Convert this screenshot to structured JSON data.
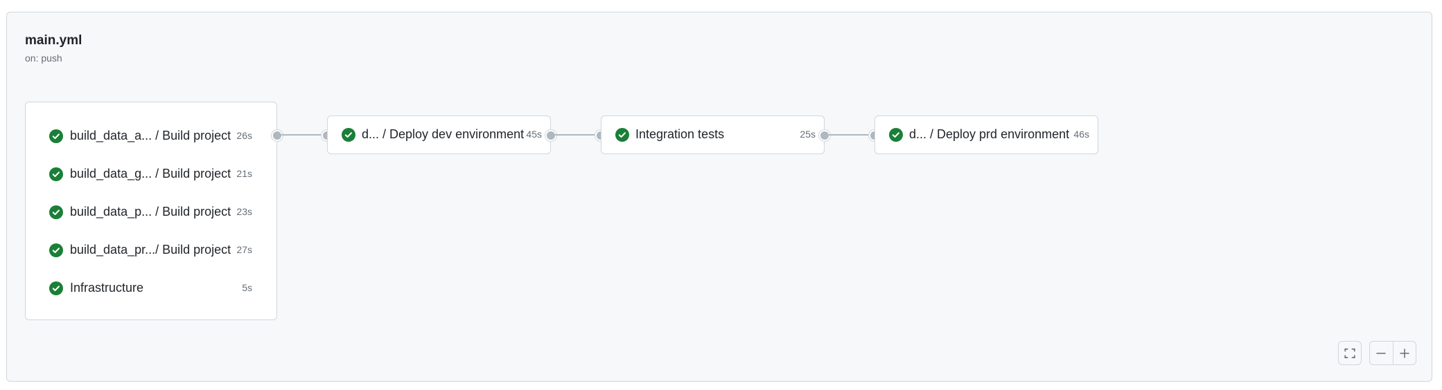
{
  "workflow": {
    "title": "main.yml",
    "trigger": "on: push"
  },
  "status_colors": {
    "success": "#1a7f37",
    "connector": "#afb8c1"
  },
  "stages": [
    {
      "jobs": [
        {
          "name": "build_data_a...  / Build project",
          "duration": "26s",
          "status": "success",
          "icon": "check-circle-icon"
        },
        {
          "name": "build_data_g...  / Build project",
          "duration": "21s",
          "status": "success",
          "icon": "check-circle-icon"
        },
        {
          "name": "build_data_p...  / Build project",
          "duration": "23s",
          "status": "success",
          "icon": "check-circle-icon"
        },
        {
          "name": "build_data_pr.../ Build project",
          "duration": "27s",
          "status": "success",
          "icon": "check-circle-icon"
        },
        {
          "name": "Infrastructure",
          "duration": "5s",
          "status": "success",
          "icon": "check-circle-icon"
        }
      ]
    },
    {
      "jobs": [
        {
          "name": "d... / Deploy dev environment",
          "duration": "45s",
          "status": "success",
          "icon": "check-circle-icon"
        }
      ]
    },
    {
      "jobs": [
        {
          "name": "Integration tests",
          "duration": "25s",
          "status": "success",
          "icon": "check-circle-icon"
        }
      ]
    },
    {
      "jobs": [
        {
          "name": "d... / Deploy prd environment",
          "duration": "46s",
          "status": "success",
          "icon": "check-circle-icon"
        }
      ]
    }
  ],
  "controls": {
    "fullscreen_icon": "fullscreen-icon",
    "zoom_out_icon": "minus-icon",
    "zoom_in_icon": "plus-icon"
  }
}
